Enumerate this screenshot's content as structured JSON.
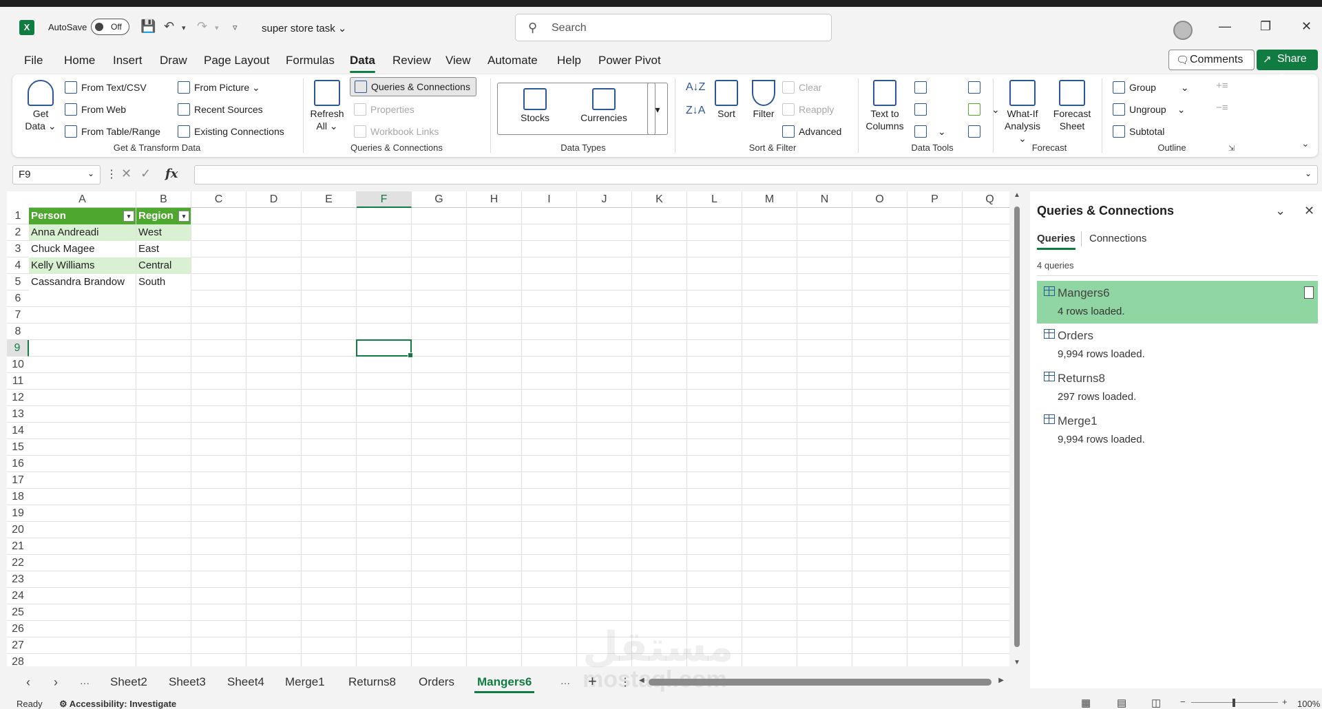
{
  "titlebar": {
    "autosave_label": "AutoSave",
    "autosave_state": "Off",
    "doc_title": "super store task",
    "search_placeholder": "Search"
  },
  "menu": {
    "items": [
      "File",
      "Home",
      "Insert",
      "Draw",
      "Page Layout",
      "Formulas",
      "Data",
      "Review",
      "View",
      "Automate",
      "Help",
      "Power Pivot"
    ],
    "active": "Data",
    "comments_label": "Comments",
    "share_label": "Share"
  },
  "ribbon": {
    "get_transform": {
      "get_data": "Get",
      "get_data2": "Data",
      "from_text_csv": "From Text/CSV",
      "from_web": "From Web",
      "from_table_range": "From Table/Range",
      "from_picture": "From Picture",
      "recent_sources": "Recent Sources",
      "existing_connections": "Existing Connections",
      "label": "Get & Transform Data"
    },
    "queries": {
      "refresh": "Refresh",
      "refresh2": "All",
      "queries_connections": "Queries & Connections",
      "properties": "Properties",
      "workbook_links": "Workbook Links",
      "label": "Queries & Connections"
    },
    "data_types": {
      "stocks": "Stocks",
      "currencies": "Currencies",
      "label": "Data Types"
    },
    "sort_filter": {
      "sort": "Sort",
      "filter": "Filter",
      "clear": "Clear",
      "reapply": "Reapply",
      "advanced": "Advanced",
      "label": "Sort & Filter"
    },
    "data_tools": {
      "text_to": "Text to",
      "columns": "Columns",
      "label": "Data Tools"
    },
    "forecast": {
      "what_if": "What-If",
      "analysis": "Analysis",
      "forecast": "Forecast",
      "sheet": "Sheet",
      "label": "Forecast"
    },
    "outline": {
      "group": "Group",
      "ungroup": "Ungroup",
      "subtotal": "Subtotal",
      "label": "Outline"
    }
  },
  "formula_bar": {
    "name_box": "F9",
    "fx": "fx",
    "formula": ""
  },
  "grid": {
    "columns": [
      "A",
      "B",
      "C",
      "D",
      "E",
      "F",
      "G",
      "H",
      "I",
      "J",
      "K",
      "L",
      "M",
      "N",
      "O",
      "P",
      "Q"
    ],
    "rows": [
      "1",
      "2",
      "3",
      "4",
      "5",
      "6",
      "7",
      "8",
      "9",
      "10",
      "11",
      "12",
      "13",
      "14",
      "15",
      "16",
      "17",
      "18",
      "19",
      "20",
      "21",
      "22",
      "23",
      "24",
      "25",
      "26",
      "27",
      "28"
    ],
    "selected_column": "F",
    "selected_row": "9",
    "table": {
      "headers": [
        "Person",
        "Region"
      ],
      "rows": [
        [
          "Anna Andreadi",
          "West"
        ],
        [
          "Chuck Magee",
          "East"
        ],
        [
          "Kelly Williams",
          "Central"
        ],
        [
          "Cassandra Brandow",
          "South"
        ]
      ]
    }
  },
  "sheets": {
    "tabs": [
      "Sheet2",
      "Sheet3",
      "Sheet4",
      "Merge1",
      "Returns8",
      "Orders",
      "Mangers6"
    ],
    "active": "Mangers6",
    "more": "···"
  },
  "status": {
    "ready": "Ready",
    "accessibility": "Accessibility: Investigate",
    "zoom": "100%"
  },
  "queries_panel": {
    "title": "Queries & Connections",
    "tab_queries": "Queries",
    "tab_connections": "Connections",
    "count": "4 queries",
    "items": [
      {
        "name": "Mangers6",
        "status": "4 rows loaded."
      },
      {
        "name": "Orders",
        "status": "9,994 rows loaded."
      },
      {
        "name": "Returns8",
        "status": "297 rows loaded."
      },
      {
        "name": "Merge1",
        "status": "9,994 rows loaded."
      }
    ]
  },
  "watermark": {
    "arabic": "مستقل",
    "latin": "mostaql.com"
  },
  "colors": {
    "accent": "#107c41",
    "table_header": "#4ea72e",
    "table_band": "#d9f0d3",
    "query_selected": "#8fd6a2"
  }
}
